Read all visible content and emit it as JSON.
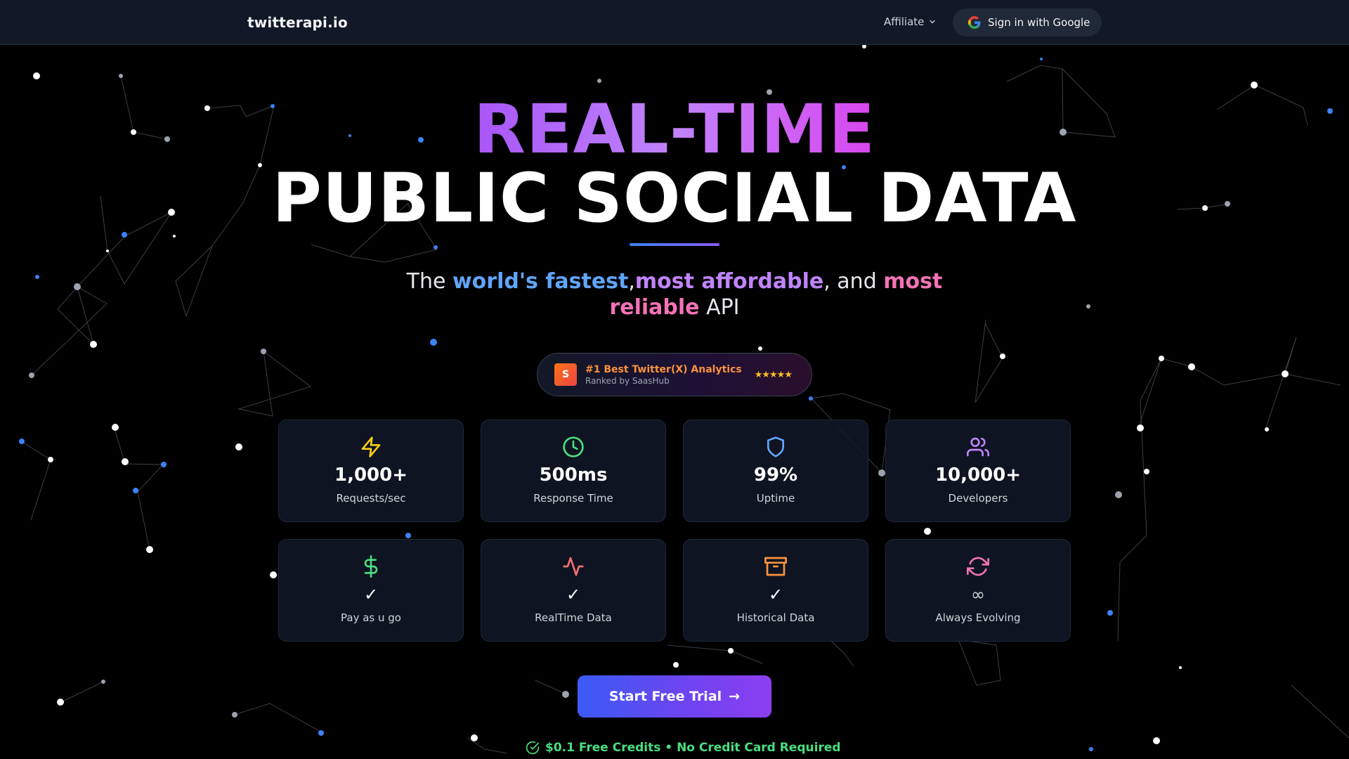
{
  "nav": {
    "brand": "twitterapi.io",
    "affiliate_label": "Affiliate",
    "signin_label": "Sign in with Google"
  },
  "hero": {
    "title_line1": "REAL-TIME",
    "title_line2": "PUBLIC SOCIAL DATA",
    "subtitle": {
      "prefix": "The ",
      "fastest": "world's fastest",
      "sep1": ",",
      "affordable": "most affordable",
      "sep2": ", and ",
      "reliable": "most reliable",
      "suffix": " API"
    }
  },
  "badge": {
    "logo_letter": "S",
    "title": "#1 Best Twitter(X) Analytics",
    "subtitle": "Ranked by SaasHub",
    "stars": "★★★★★"
  },
  "stats": [
    {
      "icon": "lightning-icon",
      "value": "1,000+",
      "label": "Requests/sec",
      "color": "#facc15"
    },
    {
      "icon": "clock-icon",
      "value": "500ms",
      "label": "Response Time",
      "color": "#4ade80"
    },
    {
      "icon": "shield-icon",
      "value": "99%",
      "label": "Uptime",
      "color": "#60a5fa"
    },
    {
      "icon": "users-icon",
      "value": "10,000+",
      "label": "Developers",
      "color": "#c084fc"
    }
  ],
  "features": [
    {
      "icon": "dollar-icon",
      "mark": "✓",
      "label": "Pay as u go",
      "color": "#4ade80"
    },
    {
      "icon": "activity-icon",
      "mark": "✓",
      "label": "RealTime Data",
      "color": "#f87171"
    },
    {
      "icon": "archive-icon",
      "mark": "✓",
      "label": "Historical Data",
      "color": "#fb923c"
    },
    {
      "icon": "refresh-icon",
      "mark": "∞",
      "label": "Always Evolving",
      "color": "#f472b6"
    }
  ],
  "cta": {
    "label": "Start Free Trial",
    "arrow": "→"
  },
  "footnote": {
    "text": "$0.1 Free Credits • No Credit Card Required"
  }
}
